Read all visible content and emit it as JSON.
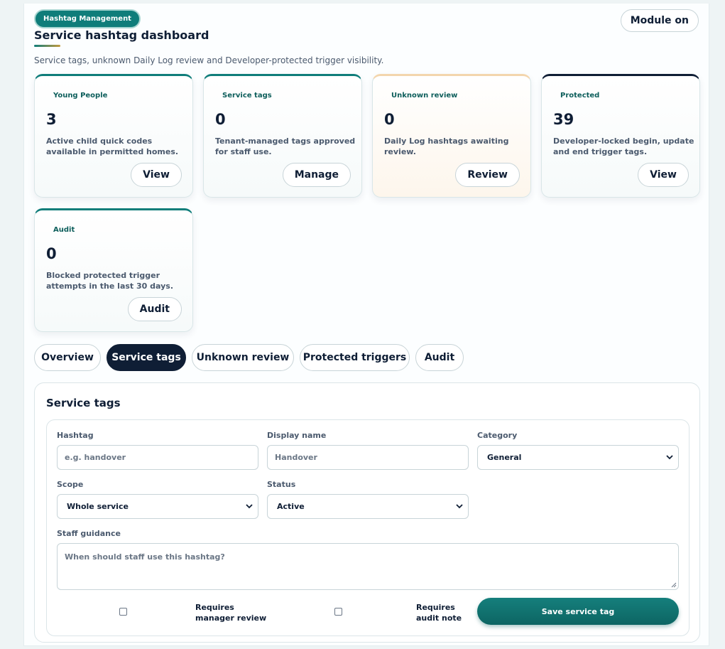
{
  "header": {
    "badge": "Hashtag Management",
    "title": "Service hashtag dashboard",
    "subtitle": "Service tags, unknown Daily Log review and Developer-protected trigger visibility.",
    "module_button": "Module on"
  },
  "cards": [
    {
      "label": "Young People",
      "value": "3",
      "description": "Active child quick codes available in permitted homes.",
      "button": "View"
    },
    {
      "label": "Service tags",
      "value": "0",
      "description": "Tenant-managed tags approved for staff use.",
      "button": "Manage"
    },
    {
      "label": "Unknown review",
      "value": "0",
      "description": "Daily Log hashtags awaiting review.",
      "button": "Review"
    },
    {
      "label": "Protected",
      "value": "39",
      "description": "Developer-locked begin, update and end trigger tags.",
      "button": "View"
    },
    {
      "label": "Audit",
      "value": "0",
      "description": "Blocked protected trigger attempts in the last 30 days.",
      "button": "Audit"
    }
  ],
  "tabs": [
    "Overview",
    "Service tags",
    "Unknown review",
    "Protected triggers",
    "Audit"
  ],
  "active_tab": "Service tags",
  "form": {
    "title": "Service tags",
    "hashtag": {
      "label": "Hashtag",
      "placeholder": "e.g. handover"
    },
    "display_name": {
      "label": "Display name",
      "placeholder": "Handover"
    },
    "category": {
      "label": "Category",
      "value": "General"
    },
    "scope": {
      "label": "Scope",
      "value": "Whole service"
    },
    "status": {
      "label": "Status",
      "value": "Active"
    },
    "guidance": {
      "label": "Staff guidance",
      "placeholder": "When should staff use this hashtag?"
    },
    "requires_manager_review": {
      "line1": "Requires",
      "line2": "manager review",
      "checked": false
    },
    "requires_audit_note": {
      "line1": "Requires",
      "line2": "audit note",
      "checked": false
    },
    "save_button": "Save service tag"
  },
  "colors": {
    "accent": "#0f7d7a",
    "navy": "#0f1e35",
    "warm": "#f3d6ad"
  }
}
